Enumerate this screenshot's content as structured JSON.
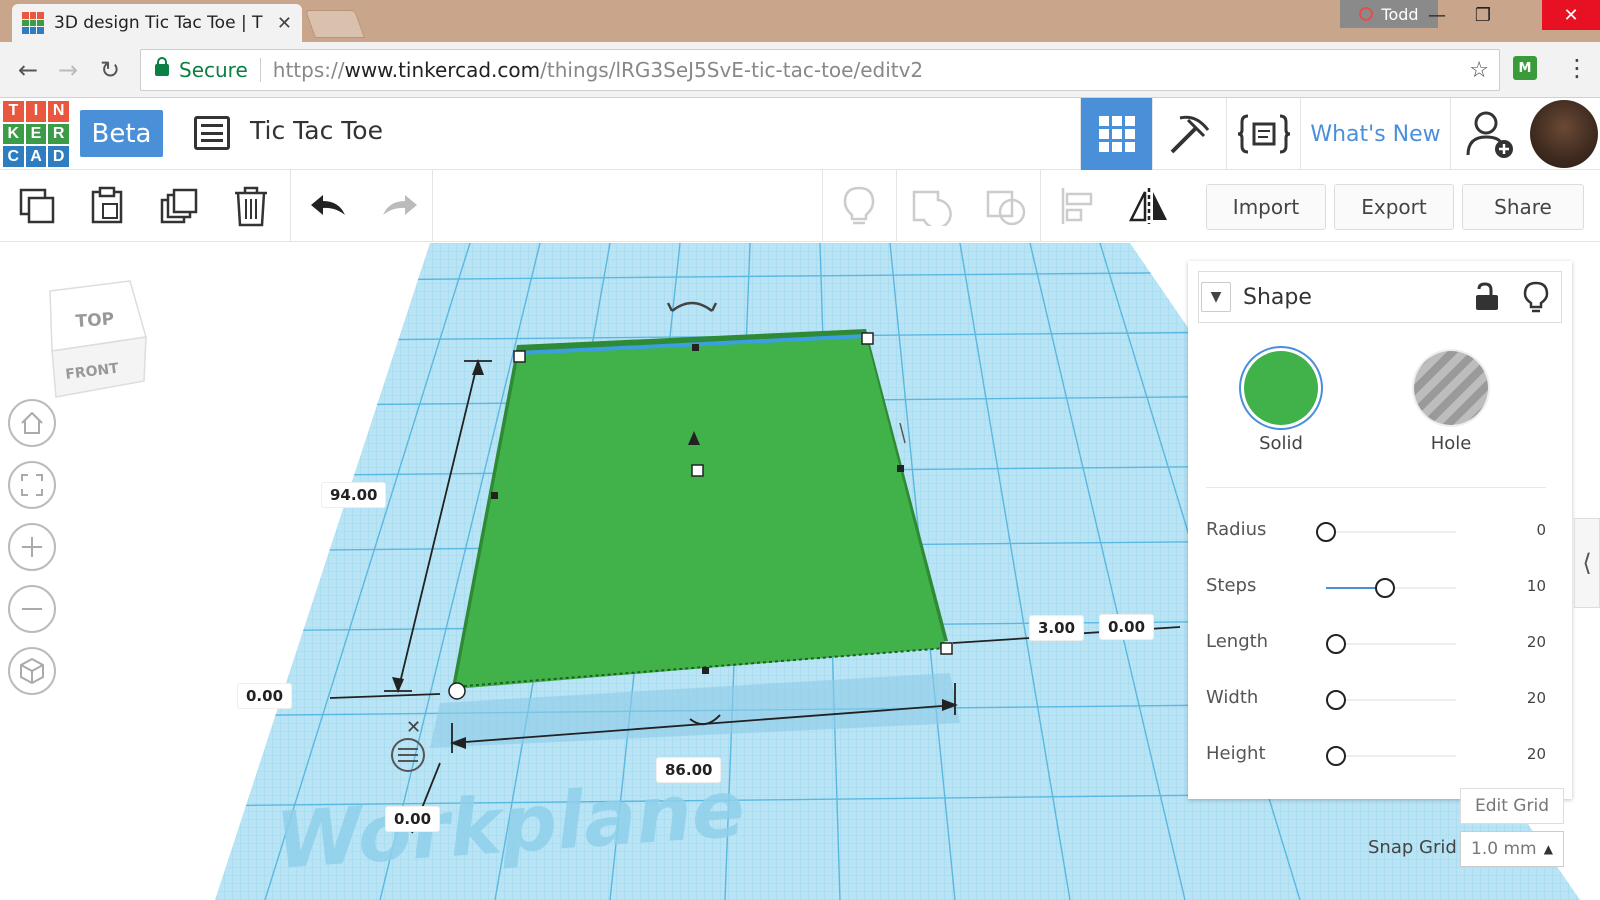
{
  "browser": {
    "tab_title": "3D design Tic Tac Toe | T",
    "tab_close": "✕",
    "profile_name": "Todd",
    "secure_label": "Secure",
    "url_prefix": "https://",
    "url_host": "www.tinkercad.com",
    "url_path": "/things/lRG3SeJ5SvE-tic-tac-toe/editv2",
    "extension_label": "M"
  },
  "app": {
    "logo_letters": [
      "T",
      "I",
      "N",
      "K",
      "E",
      "R",
      "C",
      "A",
      "D"
    ],
    "logo_colors": [
      "#e9573f",
      "#e9573f",
      "#e9573f",
      "#3c9b47",
      "#3c9b47",
      "#3c9b47",
      "#2e7dc1",
      "#2e7dc1",
      "#2e7dc1"
    ],
    "beta_label": "Beta",
    "design_title": "Tic Tac Toe",
    "whats_new": "What's New",
    "accent_color": "#4a90d9"
  },
  "toolbar": {
    "import_label": "Import",
    "export_label": "Export",
    "share_label": "Share"
  },
  "viewcube": {
    "top_label": "TOP",
    "front_label": "FRONT"
  },
  "workplane": {
    "label": "Workplane",
    "shape_color": "#41b149",
    "dimensions": {
      "depth": "94.00",
      "width": "86.00",
      "height": "3.00",
      "left_offset": "0.00",
      "front_offset": "0.00",
      "right_offset": "0.00"
    }
  },
  "shape_panel": {
    "title": "Shape",
    "solid_label": "Solid",
    "hole_label": "Hole",
    "solid_color": "#41b149",
    "properties": [
      {
        "name": "Radius",
        "value": "0",
        "fraction": 0.0
      },
      {
        "name": "Steps",
        "value": "10",
        "fraction": 0.45
      },
      {
        "name": "Length",
        "value": "20",
        "fraction": 0.08
      },
      {
        "name": "Width",
        "value": "20",
        "fraction": 0.08
      },
      {
        "name": "Height",
        "value": "20",
        "fraction": 0.08
      }
    ]
  },
  "grid": {
    "edit_grid_label": "Edit Grid",
    "snap_grid_label": "Snap Grid",
    "snap_grid_value": "1.0 mm"
  }
}
